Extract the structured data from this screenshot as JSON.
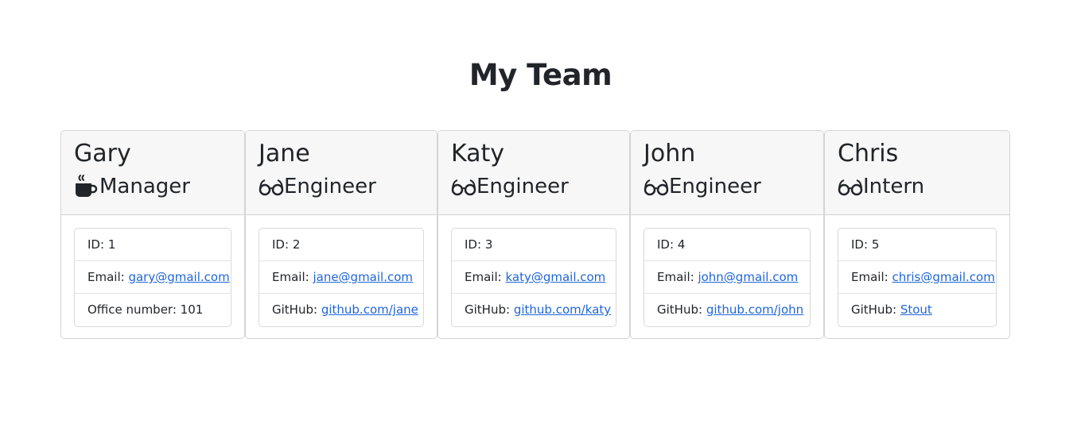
{
  "header": {
    "title": "My Team"
  },
  "icons": {
    "manager": "coffee-cup-icon",
    "engineer": "glasses-icon",
    "intern": "glasses-icon"
  },
  "colors": {
    "link": "#1f66d6",
    "text": "#212529",
    "card_header_bg": "#f7f7f7",
    "border": "#d4d4d4"
  },
  "members": [
    {
      "name": "Gary",
      "role": "Manager",
      "id_label": "ID:",
      "id": "1",
      "email_label": "Email:",
      "email": "gary@gmail.com",
      "extra_label": "Office number:",
      "extra_value": "101"
    },
    {
      "name": "Jane",
      "role": "Engineer",
      "id_label": "ID:",
      "id": "2",
      "email_label": "Email:",
      "email": "jane@gmail.com",
      "extra_label": "GitHub:",
      "extra_value": "github.com/jane"
    },
    {
      "name": "Katy",
      "role": "Engineer",
      "id_label": "ID:",
      "id": "3",
      "email_label": "Email:",
      "email": "katy@gmail.com",
      "extra_label": "GitHub:",
      "extra_value": "github.com/katy"
    },
    {
      "name": "John",
      "role": "Engineer",
      "id_label": "ID:",
      "id": "4",
      "email_label": "Email:",
      "email": "john@gmail.com",
      "extra_label": "GitHub:",
      "extra_value": "github.com/john"
    },
    {
      "name": "Chris",
      "role": "Intern",
      "id_label": "ID:",
      "id": "5",
      "email_label": "Email:",
      "email": "chris@gmail.com",
      "extra_label": "GitHub:",
      "extra_value": "Stout"
    }
  ]
}
